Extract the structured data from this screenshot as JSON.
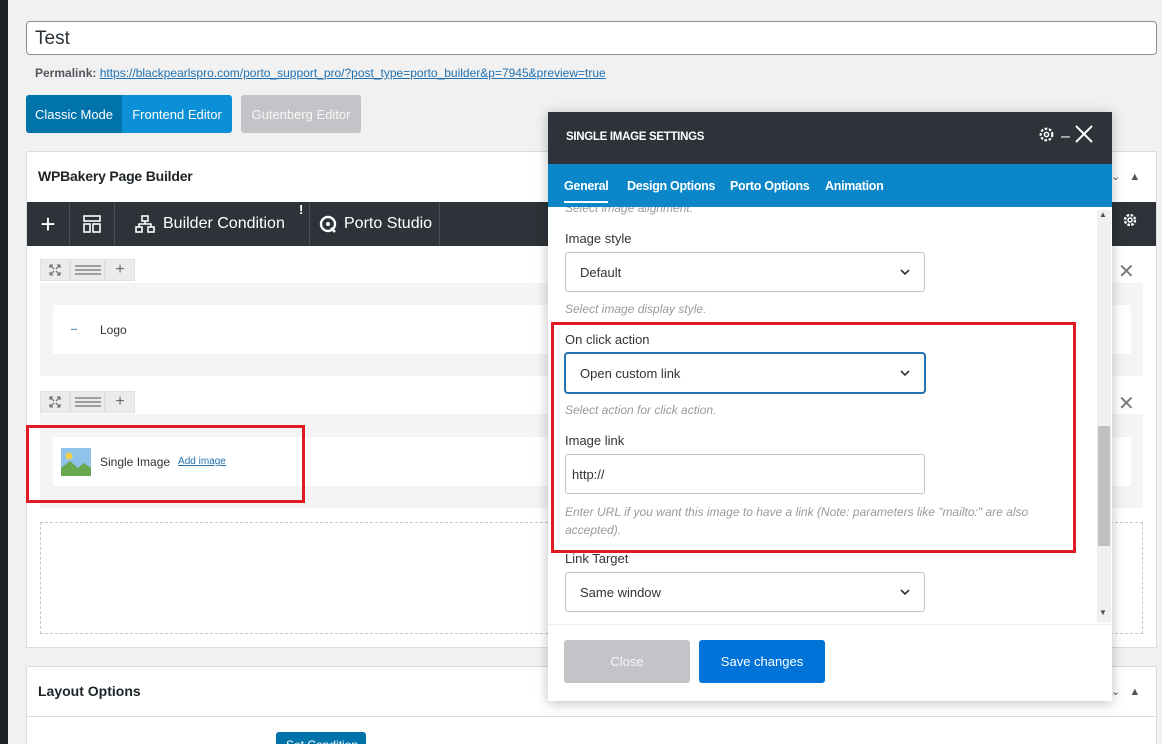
{
  "post": {
    "title": "Test",
    "permalink_label": "Permalink:",
    "permalink_url": "https://blackpearlspro.com/porto_support_pro/?post_type=porto_builder&p=7945&preview=true"
  },
  "modes": {
    "classic": "Classic Mode",
    "frontend": "Frontend Editor",
    "gutenberg": "Gutenberg Editor"
  },
  "wpbakery": {
    "title": "WPBakery Page Builder",
    "toolbar": {
      "builder_condition": "Builder Condition",
      "porto_studio": "Porto Studio",
      "alert_mark": "!"
    },
    "rows": [
      {
        "element": {
          "label": "Logo",
          "icon": "logo-thumb-icon"
        }
      },
      {
        "element": {
          "label": "Single Image",
          "action": "Add image",
          "icon": "image-placeholder-icon"
        }
      }
    ]
  },
  "layout_options": {
    "title": "Layout Options",
    "set_condition": "Set Condition"
  },
  "modal": {
    "title": "SINGLE IMAGE SETTINGS",
    "tabs": [
      "General",
      "Design Options",
      "Porto Options",
      "Animation"
    ],
    "active_tab": "General",
    "cut_hint": "Select image alignment.",
    "image_style": {
      "label": "Image style",
      "value": "Default",
      "hint": "Select image display style."
    },
    "on_click": {
      "label": "On click action",
      "value": "Open custom link",
      "hint": "Select action for click action."
    },
    "image_link": {
      "label": "Image link",
      "value": "http://",
      "hint_line1": "Enter URL if you want this image to have a link (Note: parameters like \"mailto:\" are also",
      "hint_line2": "accepted)."
    },
    "link_target": {
      "label": "Link Target",
      "value": "Same window"
    },
    "close_label": "Close",
    "save_label": "Save changes"
  },
  "colors": {
    "accent_blue": "#0b87c9",
    "highlight_red": "#e01b24",
    "dark_header": "#2d3338"
  }
}
